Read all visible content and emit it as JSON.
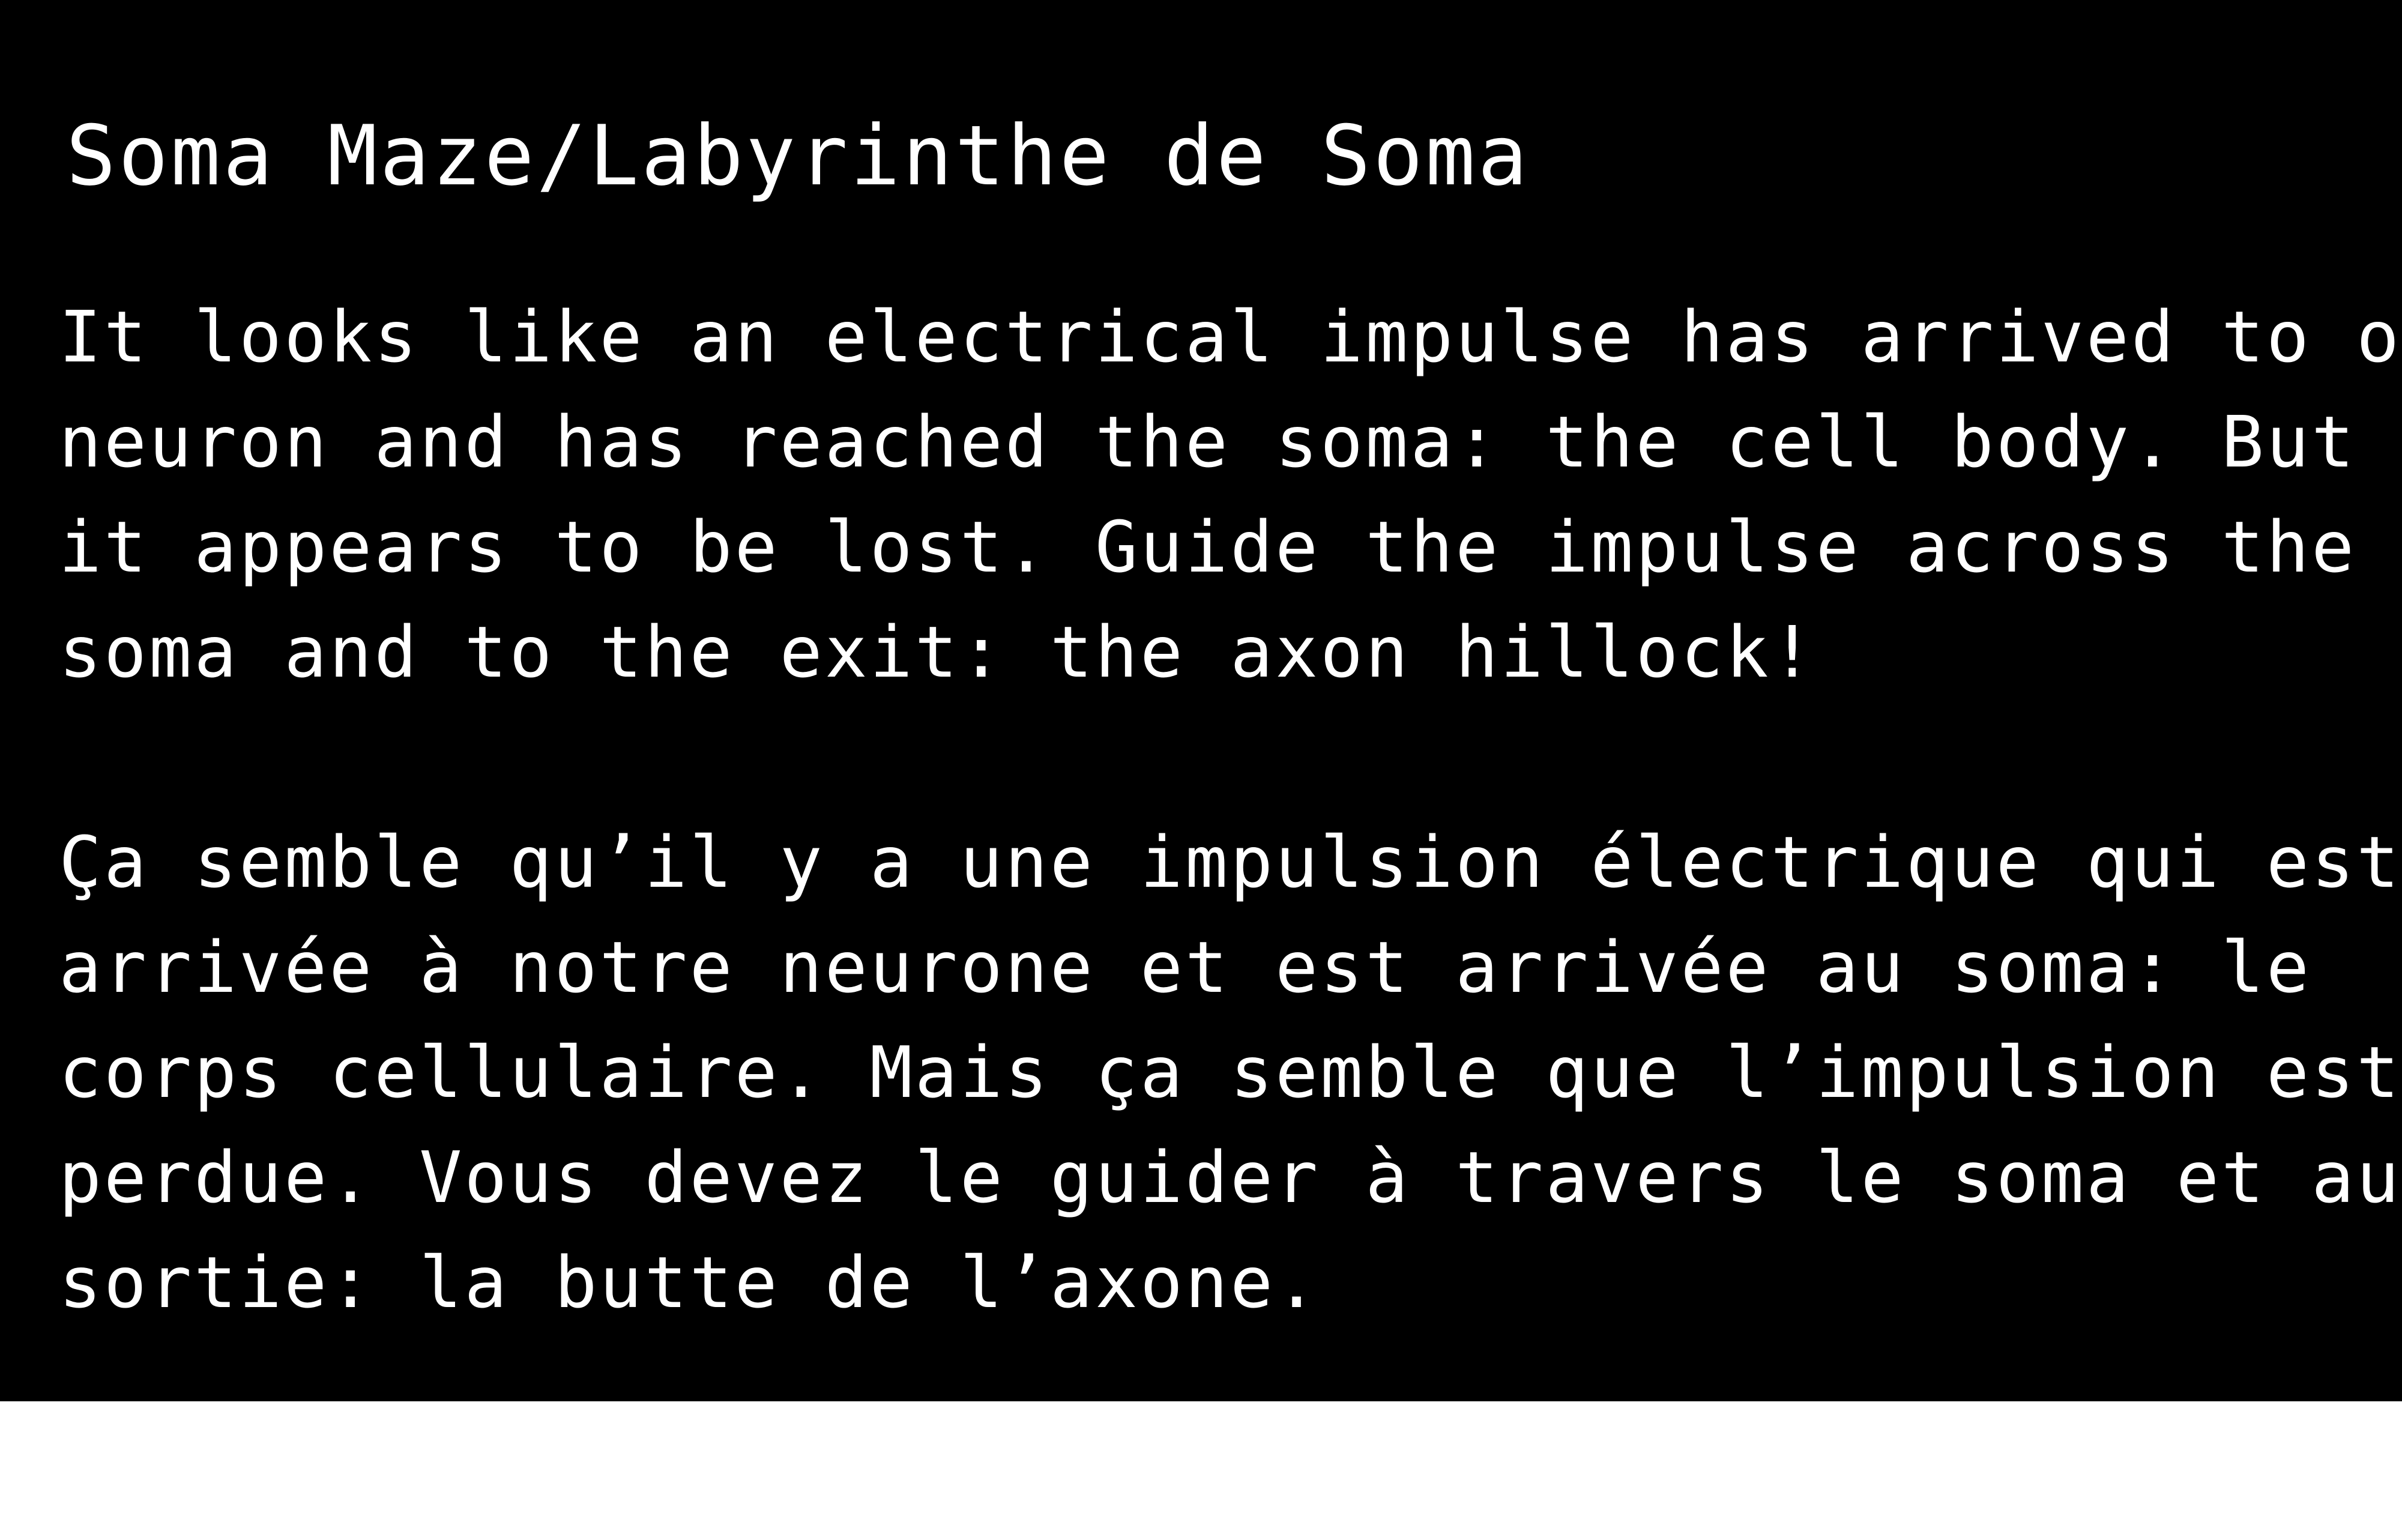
{
  "screen": {
    "background_color": "#000000",
    "text_color": "#ffffff",
    "title": "Soma Maze/Labyrinthe de Soma",
    "description_en": [
      "It looks like an electrical impulse has arrived to our",
      "neuron and has reached the soma: the cell body. But",
      "it appears to be lost. Guide the impulse across the",
      "soma and to the exit: the axon hillock!"
    ],
    "description_fr": [
      "Ça semble qu’il y a une impulsion électrique qui est",
      "arrivée à notre neurone et est arrivée au soma: le",
      "corps cellulaire. Mais ça semble que l’impulsion est",
      "perdue. Vous devez le guider à travers le soma et au",
      "sortie: la butte de l’axone."
    ]
  }
}
